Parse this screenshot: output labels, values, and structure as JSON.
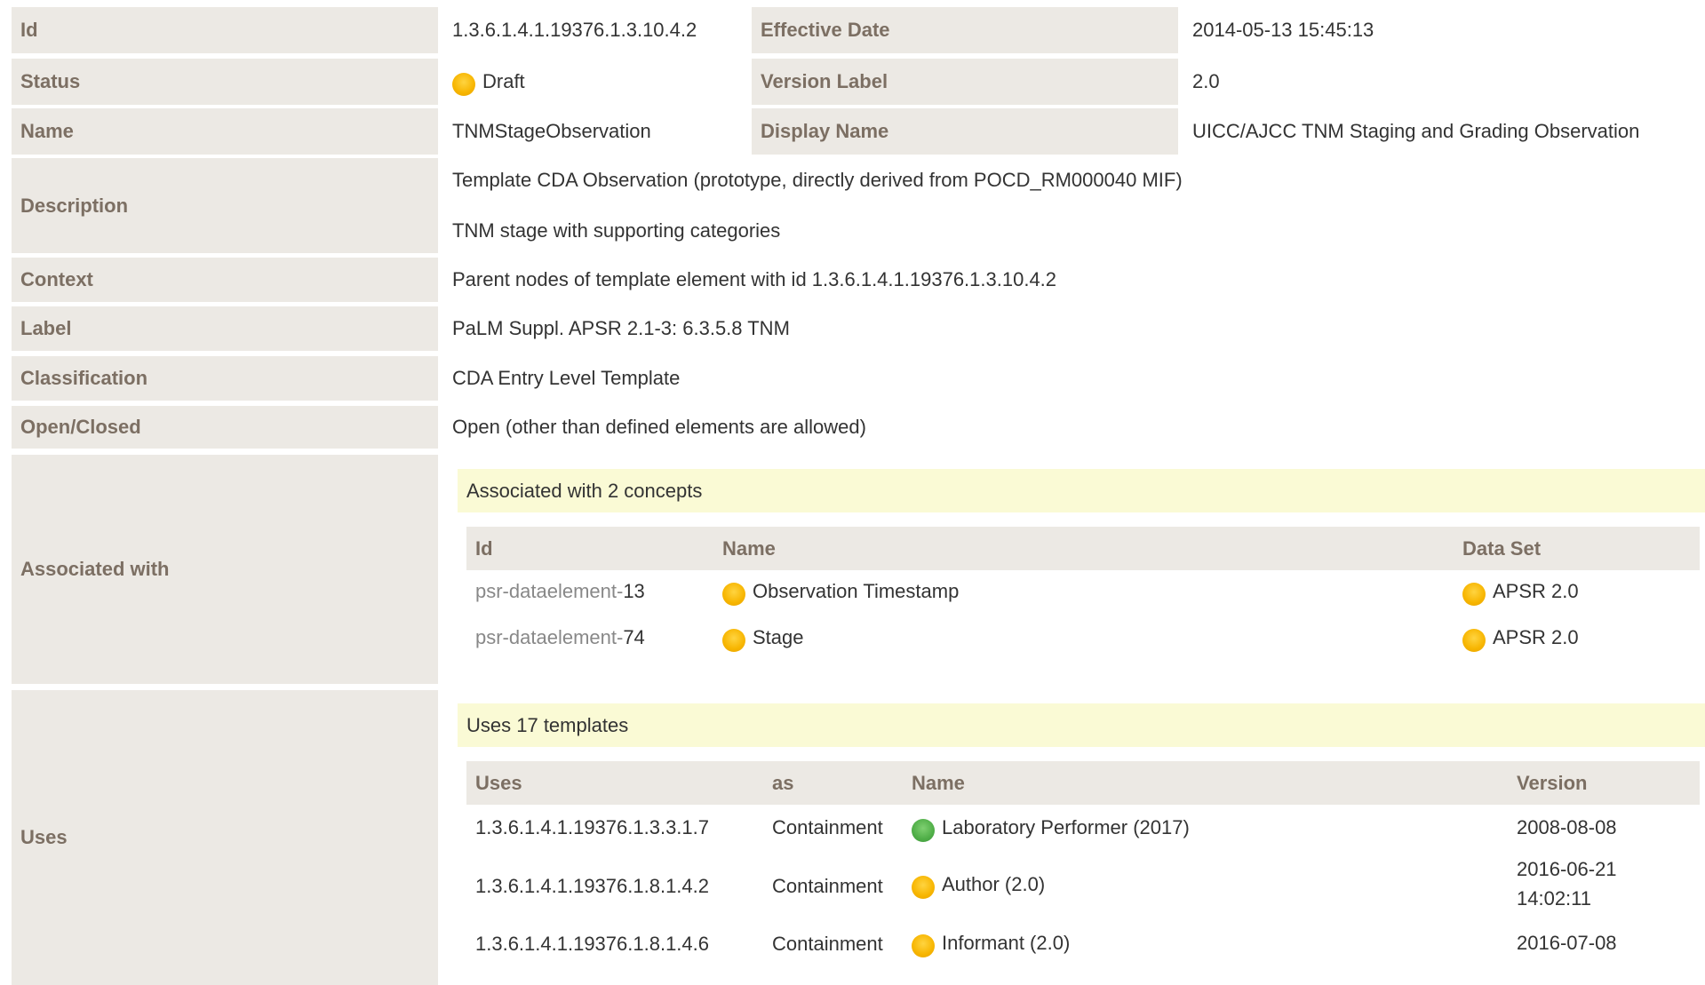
{
  "fields": {
    "id": {
      "label": "Id",
      "value": "1.3.6.1.4.1.19376.1.3.10.4.2"
    },
    "effective_date": {
      "label": "Effective Date",
      "value": "2014-05-13 15:45:13"
    },
    "status": {
      "label": "Status",
      "value": "Draft",
      "icon": "status-draft-icon",
      "color": "#f7b500"
    },
    "version_label": {
      "label": "Version Label",
      "value": "2.0"
    },
    "name": {
      "label": "Name",
      "value": "TNMStageObservation"
    },
    "display_name": {
      "label": "Display Name",
      "value": "UICC/AJCC TNM Staging and Grading Observation"
    },
    "description": {
      "label": "Description",
      "line1": "Template CDA Observation (prototype, directly derived from POCD_RM000040 MIF)",
      "line2": "TNM stage with supporting categories"
    },
    "context": {
      "label": "Context",
      "value": "Parent nodes of template element with id 1.3.6.1.4.1.19376.1.3.10.4.2"
    },
    "label": {
      "label": "Label",
      "value": "PaLM Suppl. APSR 2.1-3: 6.3.5.8 TNM"
    },
    "classification": {
      "label": "Classification",
      "value": "CDA Entry Level Template"
    },
    "open_closed": {
      "label": "Open/Closed",
      "value": "Open (other than defined elements are allowed)"
    }
  },
  "associated": {
    "label": "Associated with",
    "banner": "Associated with 2 concepts",
    "columns": {
      "id": "Id",
      "name": "Name",
      "dataset": "Data Set"
    },
    "rows": [
      {
        "id_prefix": "psr-dataelement-",
        "id_num": "13",
        "name": "Observation Timestamp",
        "dataset": "APSR 2.0"
      },
      {
        "id_prefix": "psr-dataelement-",
        "id_num": "74",
        "name": "Stage",
        "dataset": "APSR 2.0"
      }
    ]
  },
  "uses": {
    "label": "Uses",
    "banner": "Uses 17 templates",
    "columns": {
      "uses": "Uses",
      "as": "as",
      "name": "Name",
      "version": "Version"
    },
    "rows": [
      {
        "uses": "1.3.6.1.4.1.19376.1.3.3.1.7",
        "as": "Containment",
        "name": "Laboratory Performer (2017)",
        "status": "active",
        "version": "2008-08-08",
        "version_time": ""
      },
      {
        "uses": "1.3.6.1.4.1.19376.1.8.1.4.2",
        "as": "Containment",
        "name": "Author (2.0)",
        "status": "draft",
        "version": "2016-06-21",
        "version_time": "14:02:11"
      },
      {
        "uses": "1.3.6.1.4.1.19376.1.8.1.4.6",
        "as": "Containment",
        "name": "Informant (2.0)",
        "status": "draft",
        "version": "2016-07-08",
        "version_time": ""
      }
    ]
  },
  "colors": {
    "label_bg": "#ece9e4",
    "label_text": "#7c6f63",
    "banner_bg": "#fafad5",
    "draft": "#f7b500",
    "active": "#4fae47"
  }
}
